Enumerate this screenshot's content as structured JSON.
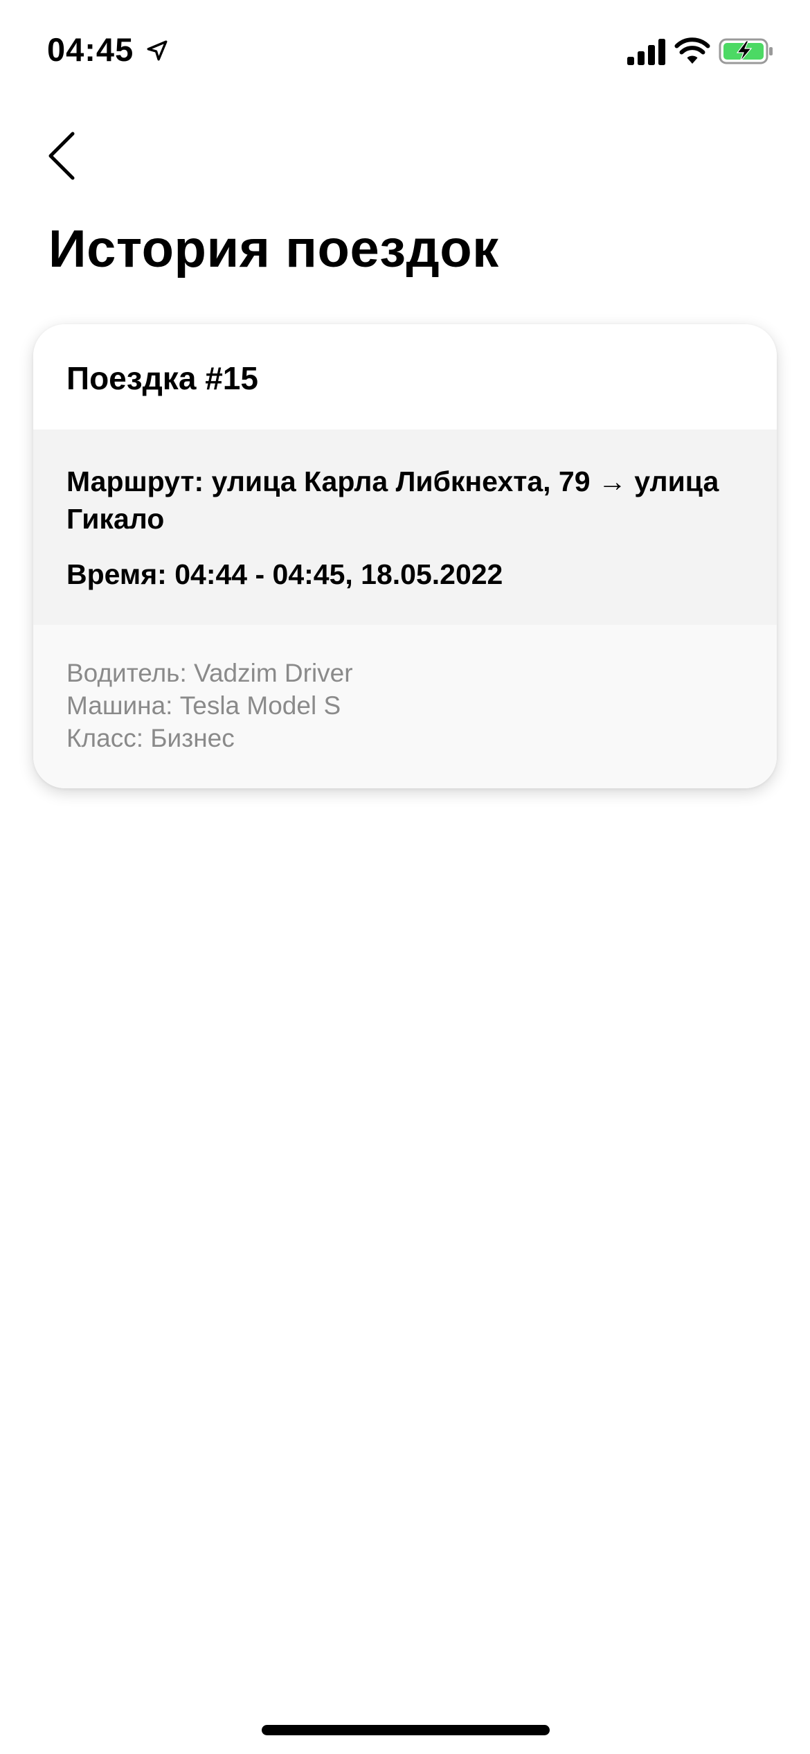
{
  "status_bar": {
    "time": "04:45",
    "icons": [
      "location-arrow-icon",
      "cellular-signal-icon",
      "wifi-icon",
      "battery-charging-icon"
    ],
    "battery_color": "#4cd964"
  },
  "nav": {
    "back_icon": "chevron-left-icon"
  },
  "page": {
    "title": "История поездок"
  },
  "trips": [
    {
      "title": "Поездка #15",
      "route": "Маршрут: улица Карла Либкнехта, 79 → улица Гикало",
      "time": "Время: 04:44 - 04:45,  18.05.2022",
      "driver": "Водитель: Vadzim Driver",
      "car": "Машина: Tesla Model S",
      "class": "Класс: Бизнес"
    }
  ]
}
